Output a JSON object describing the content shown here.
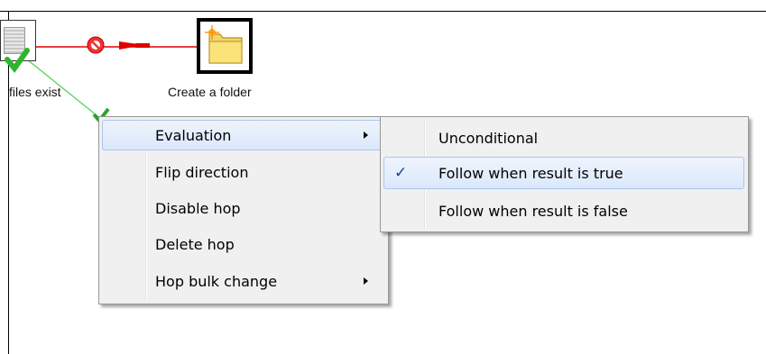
{
  "canvas": {
    "entries": [
      {
        "label": "files exist",
        "icon": "file-exists-icon"
      },
      {
        "label": "Create a folder",
        "icon": "folder-new-icon"
      }
    ],
    "hops": [
      {
        "from": "files exist",
        "to": "Create a folder",
        "type": "disabled",
        "color": "#e00000",
        "icon": "no-entry-icon"
      },
      {
        "from": "files exist",
        "type": "follow-when-true",
        "color": "#00c800",
        "icon": "checkmark-icon"
      }
    ]
  },
  "context_menu": {
    "items": [
      {
        "label": "Evaluation",
        "has_submenu": true,
        "highlighted": true
      },
      {
        "label": "Flip direction",
        "has_submenu": false
      },
      {
        "label": "Disable hop",
        "has_submenu": false
      },
      {
        "label": "Delete hop",
        "has_submenu": false
      },
      {
        "label": "Hop bulk change",
        "has_submenu": true
      }
    ]
  },
  "submenu": {
    "items": [
      {
        "label": "Unconditional",
        "checked": false
      },
      {
        "label": "Follow when result is true",
        "checked": true,
        "highlighted": true
      },
      {
        "label": "Follow when result is false",
        "checked": false
      }
    ],
    "check_glyph": "✓"
  },
  "colors": {
    "menu_bg": "#f0f0f0",
    "highlight_border": "#a9c6f0",
    "hop_red": "#e00000",
    "hop_green": "#00c800"
  }
}
